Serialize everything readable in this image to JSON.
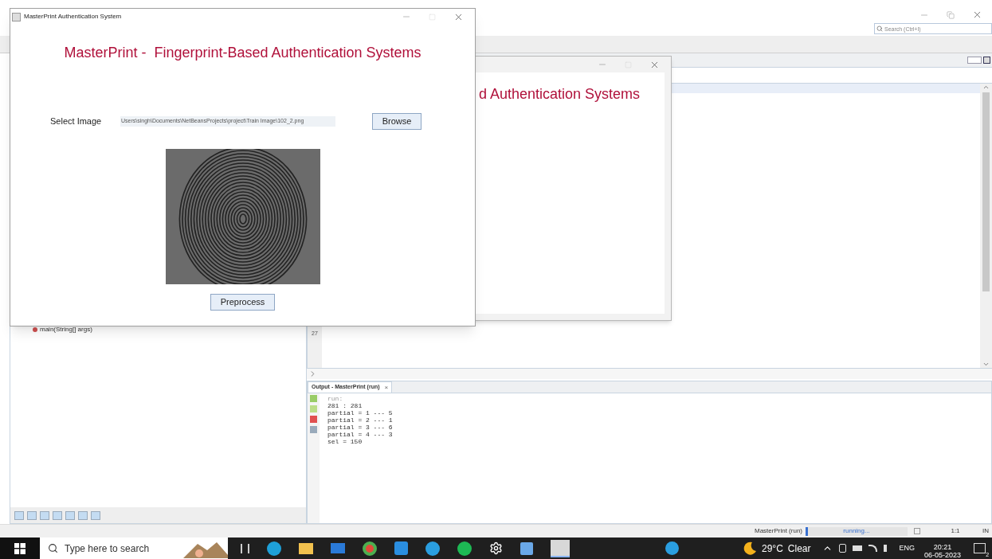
{
  "ide": {
    "search": {
      "placeholder": "Search (Ctrl+I)"
    },
    "navigator": {
      "items": [
        {
          "label": "main(String[] args)"
        }
      ]
    },
    "editor": {
      "line_number": "27"
    },
    "output": {
      "tab": {
        "label": "Output - MasterPrint (run)",
        "close": "×",
        "selected": true
      },
      "lines": [
        "run:",
        "281 : 281",
        "partial = 1 --- 5",
        "partial = 2 --- 1",
        "partial = 3 --- 6",
        "partial = 4 --- 3",
        "sel = 150"
      ]
    },
    "status_bar": {
      "task": "MasterPrint (run)",
      "progress": "running...",
      "level": 0.02,
      "position": "1:1",
      "mode": "IN"
    }
  },
  "dialog_back": {
    "heading": "d Authentication Systems"
  },
  "dialog": {
    "title": "MasterPrint Authentication System",
    "heading": "MasterPrint -  Fingerprint-Based Authentication Systems",
    "select_label": "Select Image",
    "path": "Users\\singh\\Documents\\NetBeansProjects\\project\\Train Image\\102_2.png",
    "browse": "Browse",
    "preprocess": "Preprocess"
  },
  "taskbar": {
    "search": {
      "placeholder": "Type here to search"
    },
    "weather": {
      "temp": "29°C",
      "condition": "Clear"
    },
    "language": "ENG",
    "time": "20:21",
    "date": "06-05-2023",
    "notifications": "2"
  }
}
